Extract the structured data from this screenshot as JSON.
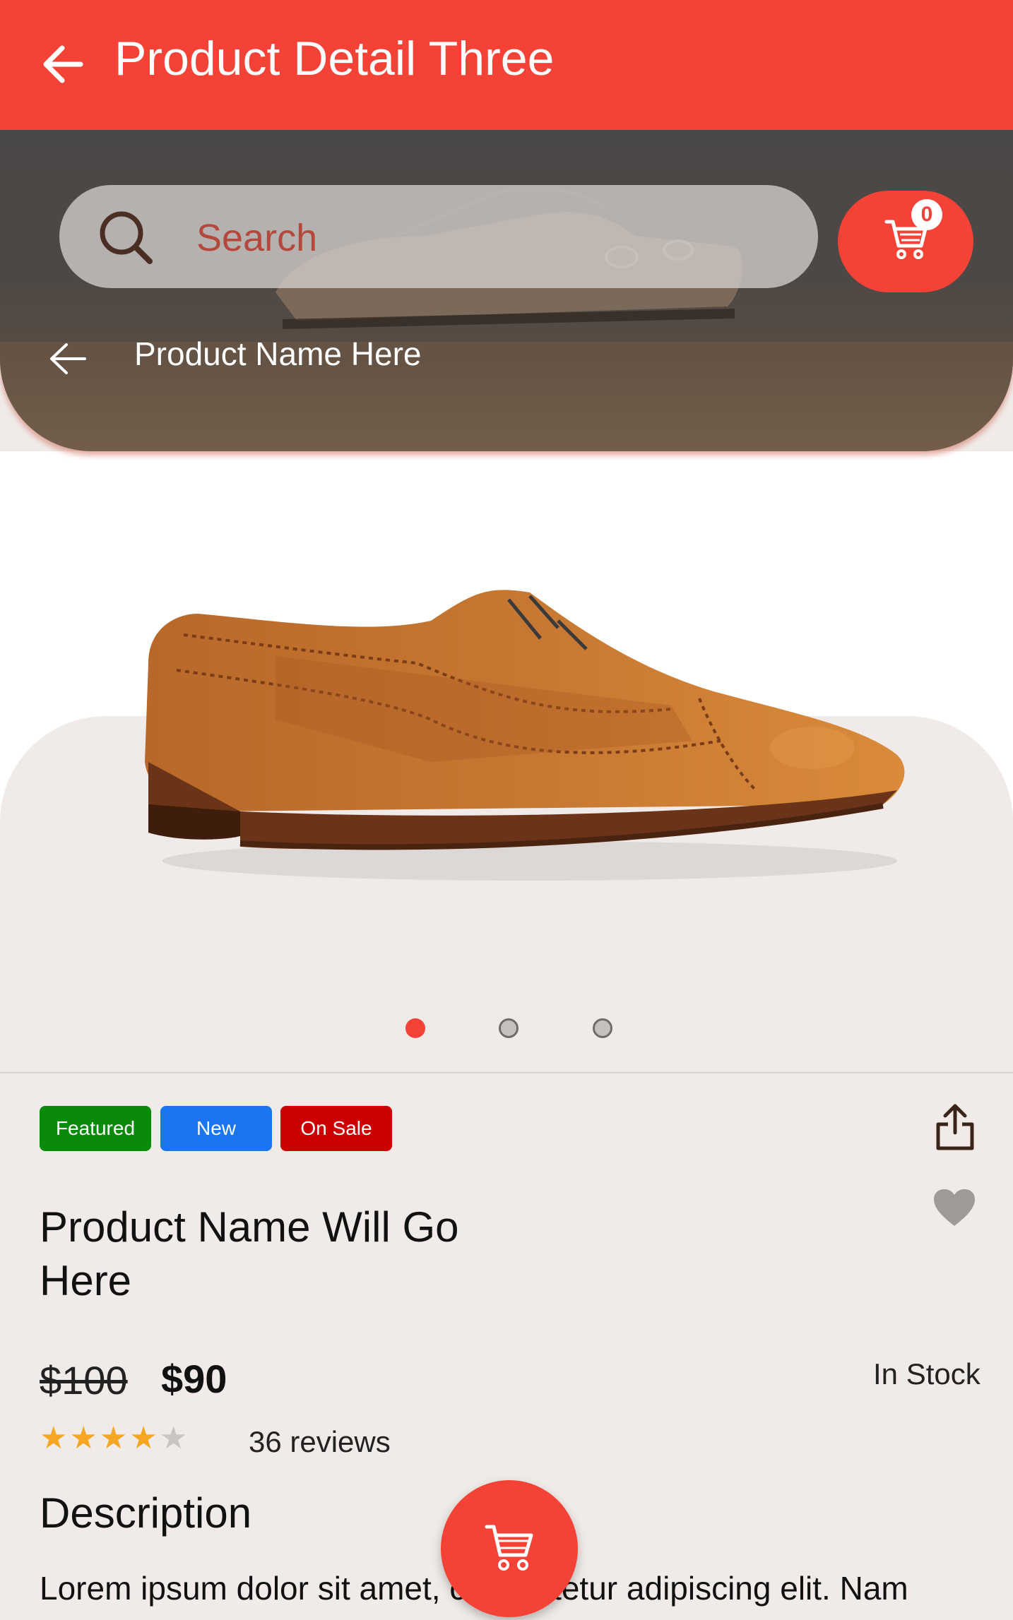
{
  "appbar": {
    "title": "Product Detail Three"
  },
  "search": {
    "placeholder": "Search"
  },
  "cart": {
    "count": "0"
  },
  "hero": {
    "title": "Product Name Here"
  },
  "gallery": {
    "slide_count": 3,
    "active_index": 0
  },
  "badges": [
    {
      "label": "Featured",
      "color": "#0a8a0a"
    },
    {
      "label": "New",
      "color": "#1976f0"
    },
    {
      "label": "On Sale",
      "color": "#cc0000"
    }
  ],
  "product": {
    "name": "Product Name Will Go Here",
    "old_price": "$100",
    "price": "$90",
    "stock": "In Stock",
    "rating": 4,
    "rating_max": 5,
    "reviews": "36 reviews"
  },
  "description": {
    "heading": "Description",
    "text": "Lorem ipsum dolor sit amet, consectetur adipiscing elit. Nam"
  },
  "colors": {
    "accent": "#f44336",
    "star": "#f5a623",
    "star_empty": "#c8c5c3"
  }
}
